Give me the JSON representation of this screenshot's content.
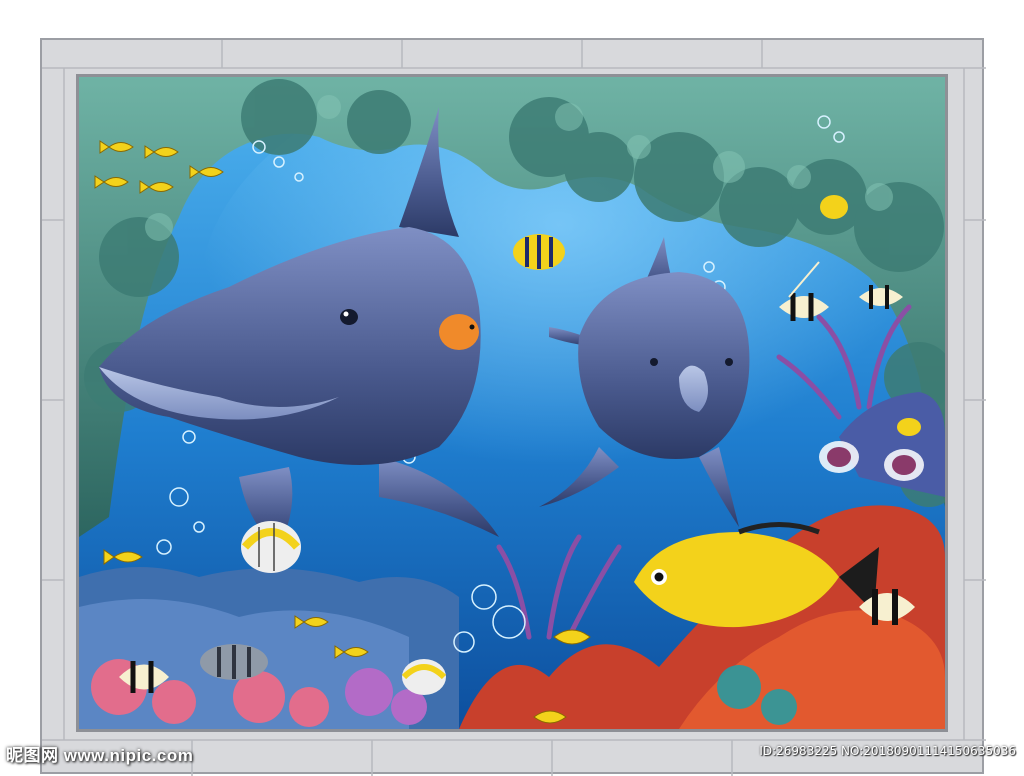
{
  "watermark": {
    "text": "昵图网 www.nipic.com"
  },
  "image_id": {
    "text": "ID:26983225 NO:20180901114150635036"
  },
  "colors": {
    "water_light": "#4fb3ef",
    "water_dark": "#0d4f9e",
    "rock": "#4f8f86",
    "coral_red": "#d9452b",
    "coral_purple": "#8a4fa5",
    "fish_yellow": "#f3d21b",
    "dolphin": "#5a6a9c"
  }
}
